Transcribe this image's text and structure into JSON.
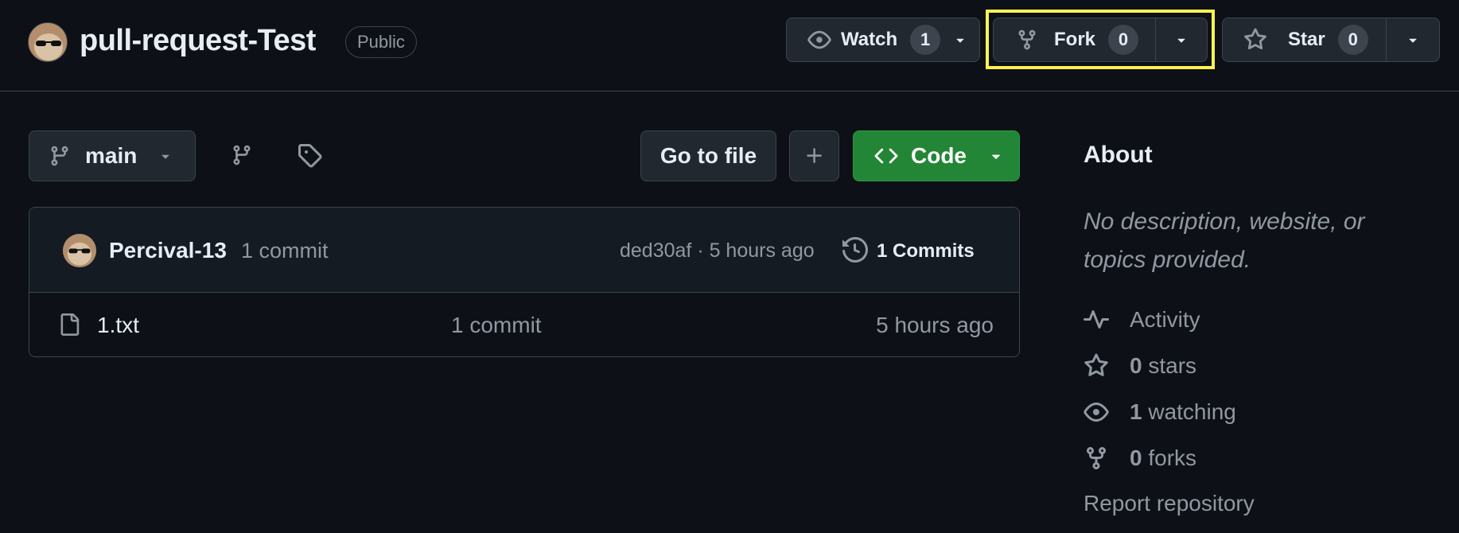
{
  "repo": {
    "title": "pull-request-Test",
    "visibility": "Public"
  },
  "header": {
    "watch_label": "Watch",
    "watch_count": "1",
    "fork_label": "Fork",
    "fork_count": "0",
    "star_label": "Star",
    "star_count": "0"
  },
  "toolbar": {
    "branch": "main",
    "go_to_file": "Go to file",
    "code_label": "Code"
  },
  "latest_commit": {
    "author": "Percival-13",
    "message": "1 commit",
    "meta": "ded30af · 5 hours ago",
    "commits_link": "1 Commits"
  },
  "files": [
    {
      "name": "1.txt",
      "commit": "1 commit",
      "time": "5 hours ago"
    }
  ],
  "about": {
    "title": "About",
    "description": "No description, website, or topics provided.",
    "activity": "Activity",
    "stars_num": "0",
    "stars_txt": " stars",
    "watching_num": "1",
    "watching_txt": " watching",
    "forks_num": "0",
    "forks_txt": " forks",
    "report": "Report repository"
  },
  "colors": {
    "background": "#0d1117",
    "code_button": "#238636",
    "highlight": "#fff44f",
    "border": "#3d444d"
  },
  "icons": [
    "eye-icon",
    "fork-icon",
    "star-icon",
    "branch-icon",
    "tag-icon",
    "plus-icon",
    "code-icon",
    "history-icon",
    "file-icon",
    "pulse-icon",
    "caret-down-icon"
  ]
}
